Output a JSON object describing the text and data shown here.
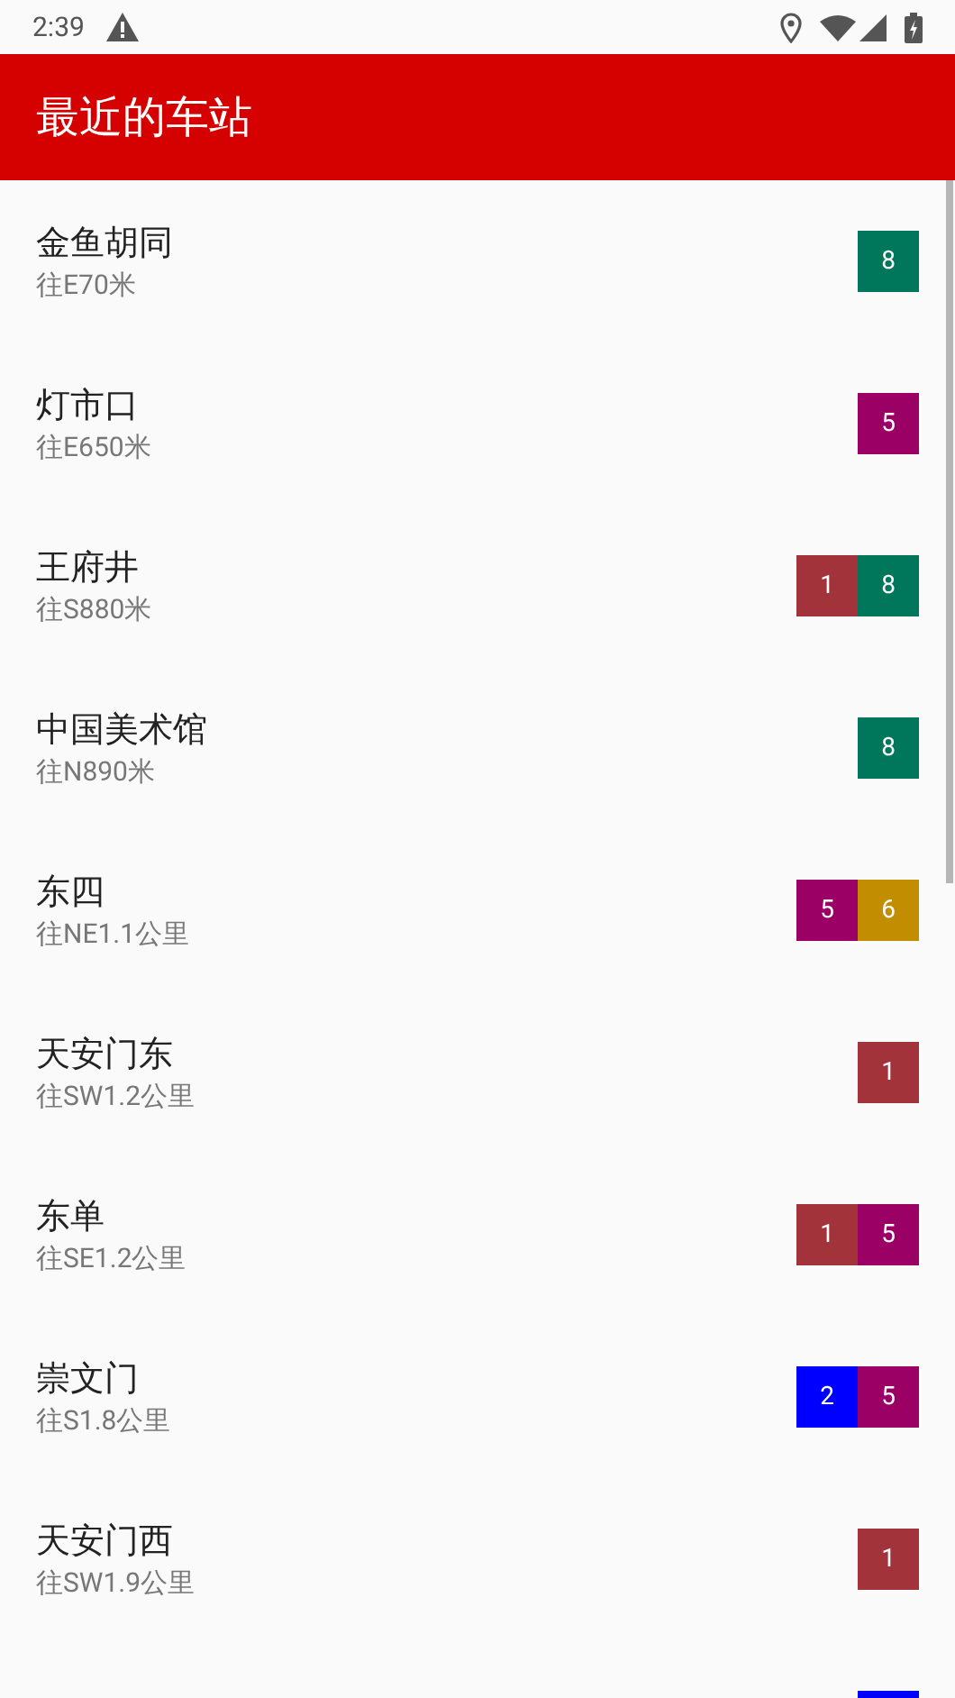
{
  "status_bar": {
    "time": "2:39"
  },
  "app_bar": {
    "title": "最近的车站"
  },
  "stations": [
    {
      "name": "金鱼胡同",
      "distance": "往E70米",
      "lines": [
        {
          "label": "8",
          "color": "#00775b"
        }
      ]
    },
    {
      "name": "灯市口",
      "distance": "往E650米",
      "lines": [
        {
          "label": "5",
          "color": "#9b0065"
        }
      ]
    },
    {
      "name": "王府井",
      "distance": "往S880米",
      "lines": [
        {
          "label": "1",
          "color": "#a3333a"
        },
        {
          "label": "8",
          "color": "#00775b"
        }
      ]
    },
    {
      "name": "中国美术馆",
      "distance": "往N890米",
      "lines": [
        {
          "label": "8",
          "color": "#00775b"
        }
      ]
    },
    {
      "name": "东四",
      "distance": "往NE1.1公里",
      "lines": [
        {
          "label": "5",
          "color": "#9b0065"
        },
        {
          "label": "6",
          "color": "#c28e00"
        }
      ]
    },
    {
      "name": "天安门东",
      "distance": "往SW1.2公里",
      "lines": [
        {
          "label": "1",
          "color": "#a3333a"
        }
      ]
    },
    {
      "name": "东单",
      "distance": "往SE1.2公里",
      "lines": [
        {
          "label": "1",
          "color": "#a3333a"
        },
        {
          "label": "5",
          "color": "#9b0065"
        }
      ]
    },
    {
      "name": "崇文门",
      "distance": "往S1.8公里",
      "lines": [
        {
          "label": "2",
          "color": "#0000ff"
        },
        {
          "label": "5",
          "color": "#9b0065"
        }
      ]
    },
    {
      "name": "天安门西",
      "distance": "往SW1.9公里",
      "lines": [
        {
          "label": "1",
          "color": "#a3333a"
        }
      ]
    },
    {
      "lines": [
        {
          "color": "#0000ff"
        }
      ]
    }
  ]
}
